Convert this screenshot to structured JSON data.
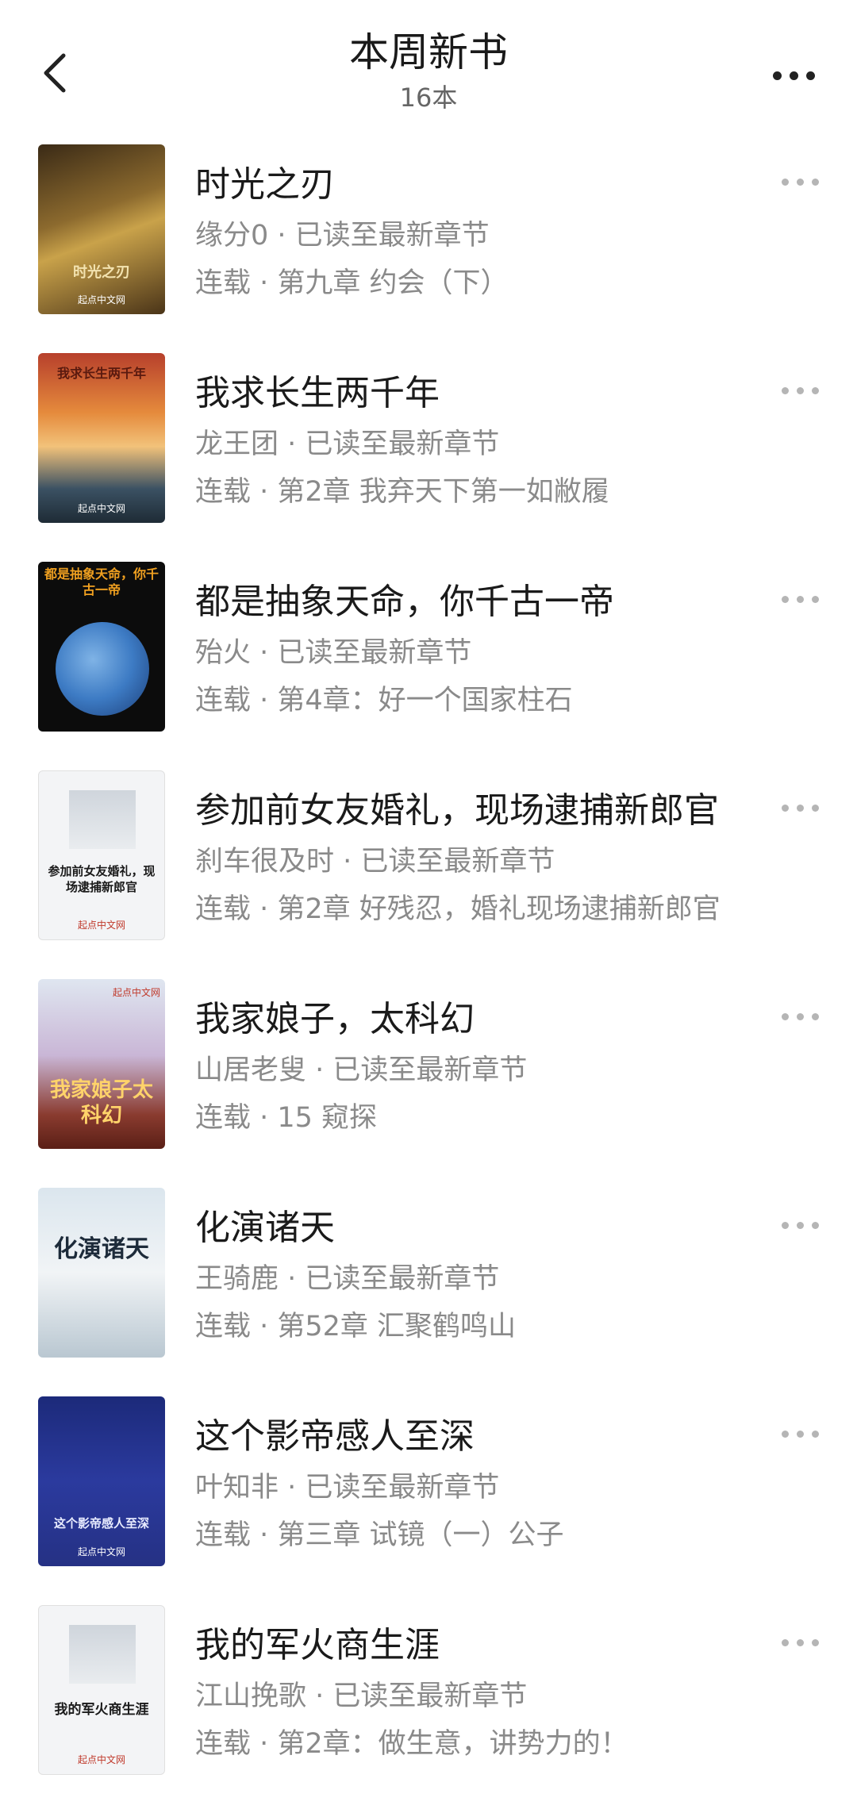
{
  "header": {
    "title": "本周新书",
    "subtitle": "16本"
  },
  "books": [
    {
      "title": "时光之刃",
      "meta": "缘分0 · 已读至最新章节",
      "chapter": "连载 · 第九章 约会（下）",
      "cover_text": "时光之刃",
      "publisher": "起点中文网"
    },
    {
      "title": "我求长生两千年",
      "meta": "龙王团 · 已读至最新章节",
      "chapter": "连载 · 第2章 我弃天下第一如敝履",
      "cover_text": "我求长生两千年",
      "publisher": "起点中文网"
    },
    {
      "title": "都是抽象天命，你千古一帝",
      "meta": "殆火 · 已读至最新章节",
      "chapter": "连载 · 第4章：好一个国家柱石",
      "cover_text": "都是抽象天命，你千古一帝",
      "publisher": ""
    },
    {
      "title": "参加前女友婚礼，现场逮捕新郎官",
      "meta": "刹车很及时 · 已读至最新章节",
      "chapter": "连载 · 第2章 好残忍，婚礼现场逮捕新郎官",
      "cover_text": "参加前女友婚礼，现场逮捕新郎官",
      "publisher": "起点中文网"
    },
    {
      "title": "我家娘子，太科幻",
      "meta": "山居老叟 · 已读至最新章节",
      "chapter": "连载 · 15 窥探",
      "cover_text": "我家娘子太科幻",
      "publisher": "起点中文网"
    },
    {
      "title": "化演诸天",
      "meta": "王骑鹿 · 已读至最新章节",
      "chapter": "连载 · 第52章 汇聚鹤鸣山",
      "cover_text": "化演诸天",
      "publisher": ""
    },
    {
      "title": "这个影帝感人至深",
      "meta": "叶知非 · 已读至最新章节",
      "chapter": "连载 · 第三章 试镜（一）公子",
      "cover_text": "这个影帝感人至深",
      "publisher": "起点中文网"
    },
    {
      "title": "我的军火商生涯",
      "meta": "江山挽歌 · 已读至最新章节",
      "chapter": "连载 · 第2章：做生意，讲势力的！",
      "cover_text": "我的军火商生涯",
      "publisher": "起点中文网"
    }
  ],
  "colors": {
    "text_primary": "#1a1a1a",
    "text_secondary": "#8a8a8a",
    "background": "#ffffff"
  }
}
